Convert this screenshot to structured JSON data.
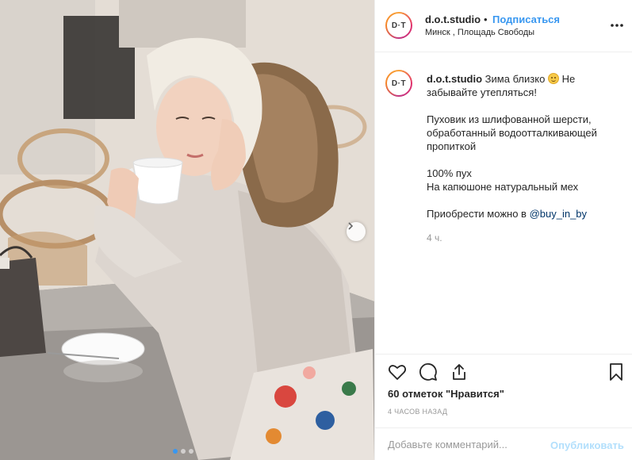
{
  "post": {
    "avatar_text": "D·T",
    "username": "d.o.t.studio",
    "bullet": "•",
    "follow_label": "Подписаться",
    "location": "Минск , Площадь Свободы",
    "more_icon": "more-horizontal-icon"
  },
  "photo": {
    "description_icon": "photo",
    "slides": 3,
    "active_slide": 1,
    "next_icon": "chevron-right-icon"
  },
  "caption": {
    "username": "d.o.t.studio",
    "line1": "Зима близко",
    "emoji": "smile-emoji",
    "line1_end": "Не забывайте утепляться!",
    "para2": "Пуховик из шлифованной шерсти, обработанный водоотталкивающей пропиткой",
    "para3_line1": "100% пух",
    "para3_line2": "На капюшоне натуральный мех",
    "para4_prefix": "Приобрести можно в ",
    "para4_mention": "@buy_in_by",
    "time": "4 ч."
  },
  "actions": {
    "like_icon": "heart-icon",
    "comment_icon": "comment-icon",
    "share_icon": "share-icon",
    "save_icon": "bookmark-icon",
    "likes": "60 отметок \"Нравится\"",
    "time_ago": "4 часов назад"
  },
  "comment": {
    "placeholder": "Добавьте комментарий...",
    "publish_label": "Опубликовать"
  },
  "colors": {
    "accent": "#3897f0",
    "publish_disabled": "#b2dffc",
    "mention": "#003569",
    "muted": "#999999"
  }
}
